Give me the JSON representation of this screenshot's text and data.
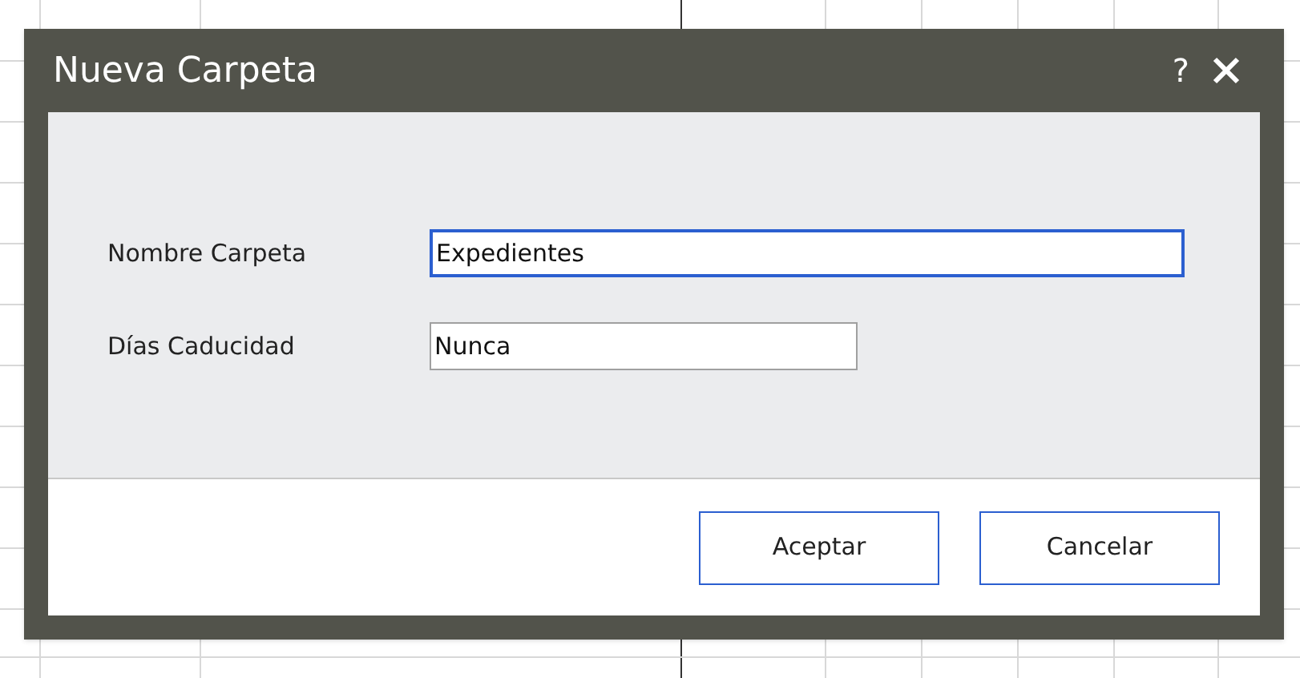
{
  "dialog": {
    "title": "Nueva Carpeta",
    "help": "?",
    "fields": [
      {
        "label": "Nombre Carpeta",
        "value": "Expedientes",
        "focused": true
      },
      {
        "label": "Días Caducidad",
        "value": "Nunca",
        "focused": false
      }
    ],
    "buttons": [
      "Aceptar",
      "Cancelar"
    ]
  }
}
